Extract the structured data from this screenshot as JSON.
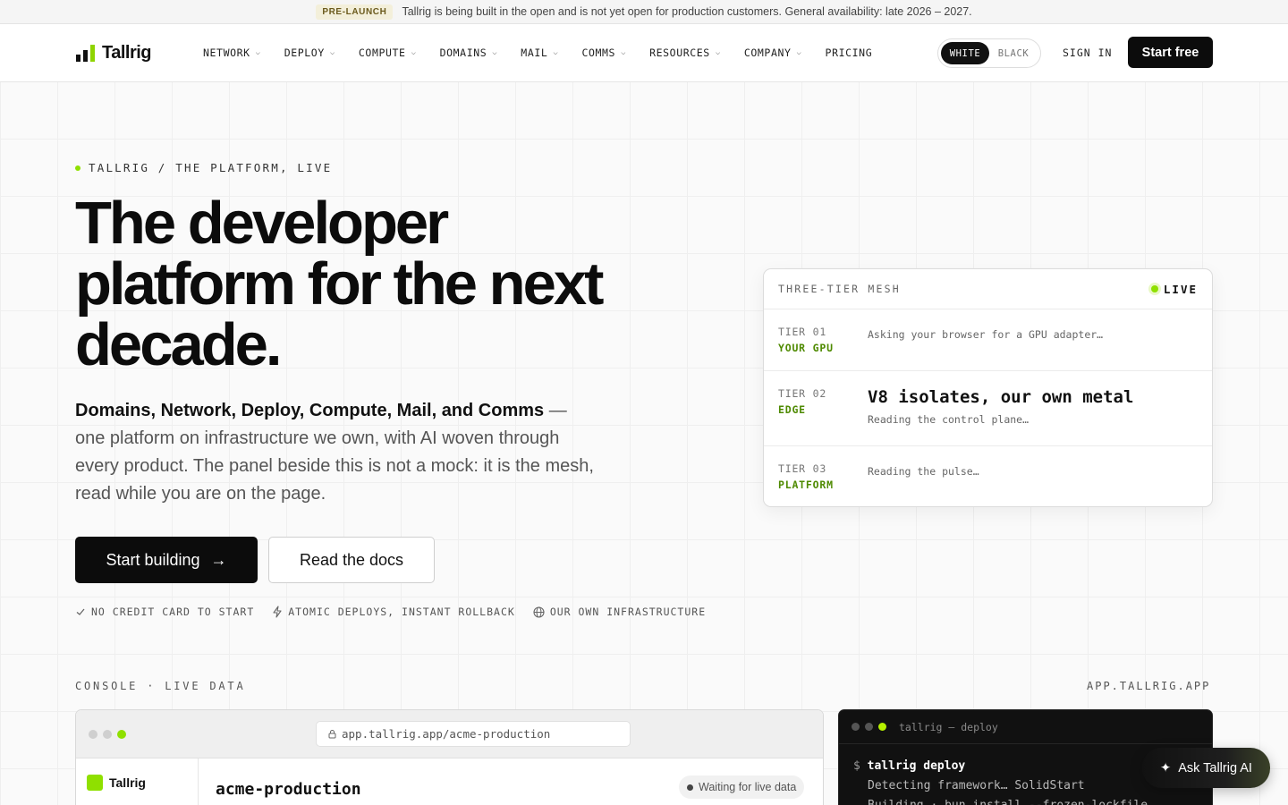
{
  "banner": {
    "badge": "PRE-LAUNCH",
    "text": "Tallrig is being built in the open and is not yet open for production customers. General availability: late 2026 – 2027."
  },
  "nav": {
    "logo": "Tallrig",
    "links": [
      {
        "label": "NETWORK",
        "dropdown": true
      },
      {
        "label": "DEPLOY",
        "dropdown": true
      },
      {
        "label": "COMPUTE",
        "dropdown": true
      },
      {
        "label": "DOMAINS",
        "dropdown": true
      },
      {
        "label": "MAIL",
        "dropdown": true
      },
      {
        "label": "COMMS",
        "dropdown": true
      },
      {
        "label": "RESOURCES",
        "dropdown": true
      },
      {
        "label": "COMPANY",
        "dropdown": true
      },
      {
        "label": "PRICING",
        "dropdown": false
      }
    ],
    "theme_toggle": {
      "white": "WHITE",
      "black": "BLACK",
      "selected": "WHITE"
    },
    "sign_in": "SIGN IN",
    "cta": "Start free"
  },
  "hero": {
    "eyebrow": "TALLRIG / THE PLATFORM, LIVE",
    "title": "The developer platform for the next decade.",
    "desc_bold": "Domains, Network, Deploy, Compute, Mail, and Comms",
    "desc_rest": " — one platform on infrastructure we own, with AI woven through every product. The panel beside this is not a mock: it is the mesh, read while you are on the page.",
    "primary_button": "Start building",
    "secondary_button": "Read the docs",
    "features": [
      {
        "icon": "check-icon",
        "label": "NO CREDIT CARD TO START"
      },
      {
        "icon": "bolt-icon",
        "label": "ATOMIC DEPLOYS, INSTANT ROLLBACK"
      },
      {
        "icon": "globe-icon",
        "label": "OUR OWN INFRASTRUCTURE"
      }
    ]
  },
  "mesh": {
    "title": "THREE-TIER MESH",
    "status": "LIVE",
    "tiers": [
      {
        "num": "TIER 01",
        "name": "YOUR GPU",
        "headline": "",
        "text": "Asking your browser for a GPU adapter…"
      },
      {
        "num": "TIER 02",
        "name": "EDGE",
        "headline": "V8 isolates, our own metal",
        "text": "Reading the control plane…"
      },
      {
        "num": "TIER 03",
        "name": "PLATFORM",
        "headline": "",
        "text": "Reading the pulse…"
      }
    ]
  },
  "console": {
    "label": "CONSOLE · LIVE DATA",
    "url_label": "APP.TALLRIG.APP",
    "browser_url": "app.tallrig.app/acme-production",
    "sidebar_logo": "Tallrig",
    "project": "acme-production",
    "status": "Waiting for live data"
  },
  "terminal": {
    "title": "tallrig — deploy",
    "prompt": "$",
    "command": "tallrig deploy",
    "lines": [
      "Detecting framework… SolidStart",
      "Building · bun install --frozen-lockfile"
    ]
  },
  "ask": {
    "label": "Ask Tallrig AI"
  },
  "colors": {
    "accent": "#8fe000",
    "tier_name": "#4e8a00",
    "dark": "#0c0c0c"
  }
}
